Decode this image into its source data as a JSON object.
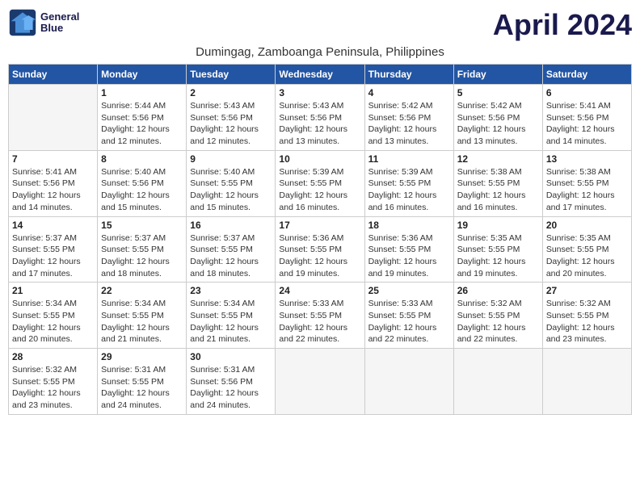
{
  "logo": {
    "line1": "General",
    "line2": "Blue"
  },
  "title": "April 2024",
  "subtitle": "Dumingag, Zamboanga Peninsula, Philippines",
  "days_of_week": [
    "Sunday",
    "Monday",
    "Tuesday",
    "Wednesday",
    "Thursday",
    "Friday",
    "Saturday"
  ],
  "weeks": [
    [
      {
        "day": "",
        "info": ""
      },
      {
        "day": "1",
        "info": "Sunrise: 5:44 AM\nSunset: 5:56 PM\nDaylight: 12 hours\nand 12 minutes."
      },
      {
        "day": "2",
        "info": "Sunrise: 5:43 AM\nSunset: 5:56 PM\nDaylight: 12 hours\nand 12 minutes."
      },
      {
        "day": "3",
        "info": "Sunrise: 5:43 AM\nSunset: 5:56 PM\nDaylight: 12 hours\nand 13 minutes."
      },
      {
        "day": "4",
        "info": "Sunrise: 5:42 AM\nSunset: 5:56 PM\nDaylight: 12 hours\nand 13 minutes."
      },
      {
        "day": "5",
        "info": "Sunrise: 5:42 AM\nSunset: 5:56 PM\nDaylight: 12 hours\nand 13 minutes."
      },
      {
        "day": "6",
        "info": "Sunrise: 5:41 AM\nSunset: 5:56 PM\nDaylight: 12 hours\nand 14 minutes."
      }
    ],
    [
      {
        "day": "7",
        "info": "Sunrise: 5:41 AM\nSunset: 5:56 PM\nDaylight: 12 hours\nand 14 minutes."
      },
      {
        "day": "8",
        "info": "Sunrise: 5:40 AM\nSunset: 5:56 PM\nDaylight: 12 hours\nand 15 minutes."
      },
      {
        "day": "9",
        "info": "Sunrise: 5:40 AM\nSunset: 5:55 PM\nDaylight: 12 hours\nand 15 minutes."
      },
      {
        "day": "10",
        "info": "Sunrise: 5:39 AM\nSunset: 5:55 PM\nDaylight: 12 hours\nand 16 minutes."
      },
      {
        "day": "11",
        "info": "Sunrise: 5:39 AM\nSunset: 5:55 PM\nDaylight: 12 hours\nand 16 minutes."
      },
      {
        "day": "12",
        "info": "Sunrise: 5:38 AM\nSunset: 5:55 PM\nDaylight: 12 hours\nand 16 minutes."
      },
      {
        "day": "13",
        "info": "Sunrise: 5:38 AM\nSunset: 5:55 PM\nDaylight: 12 hours\nand 17 minutes."
      }
    ],
    [
      {
        "day": "14",
        "info": "Sunrise: 5:37 AM\nSunset: 5:55 PM\nDaylight: 12 hours\nand 17 minutes."
      },
      {
        "day": "15",
        "info": "Sunrise: 5:37 AM\nSunset: 5:55 PM\nDaylight: 12 hours\nand 18 minutes."
      },
      {
        "day": "16",
        "info": "Sunrise: 5:37 AM\nSunset: 5:55 PM\nDaylight: 12 hours\nand 18 minutes."
      },
      {
        "day": "17",
        "info": "Sunrise: 5:36 AM\nSunset: 5:55 PM\nDaylight: 12 hours\nand 19 minutes."
      },
      {
        "day": "18",
        "info": "Sunrise: 5:36 AM\nSunset: 5:55 PM\nDaylight: 12 hours\nand 19 minutes."
      },
      {
        "day": "19",
        "info": "Sunrise: 5:35 AM\nSunset: 5:55 PM\nDaylight: 12 hours\nand 19 minutes."
      },
      {
        "day": "20",
        "info": "Sunrise: 5:35 AM\nSunset: 5:55 PM\nDaylight: 12 hours\nand 20 minutes."
      }
    ],
    [
      {
        "day": "21",
        "info": "Sunrise: 5:34 AM\nSunset: 5:55 PM\nDaylight: 12 hours\nand 20 minutes."
      },
      {
        "day": "22",
        "info": "Sunrise: 5:34 AM\nSunset: 5:55 PM\nDaylight: 12 hours\nand 21 minutes."
      },
      {
        "day": "23",
        "info": "Sunrise: 5:34 AM\nSunset: 5:55 PM\nDaylight: 12 hours\nand 21 minutes."
      },
      {
        "day": "24",
        "info": "Sunrise: 5:33 AM\nSunset: 5:55 PM\nDaylight: 12 hours\nand 22 minutes."
      },
      {
        "day": "25",
        "info": "Sunrise: 5:33 AM\nSunset: 5:55 PM\nDaylight: 12 hours\nand 22 minutes."
      },
      {
        "day": "26",
        "info": "Sunrise: 5:32 AM\nSunset: 5:55 PM\nDaylight: 12 hours\nand 22 minutes."
      },
      {
        "day": "27",
        "info": "Sunrise: 5:32 AM\nSunset: 5:55 PM\nDaylight: 12 hours\nand 23 minutes."
      }
    ],
    [
      {
        "day": "28",
        "info": "Sunrise: 5:32 AM\nSunset: 5:55 PM\nDaylight: 12 hours\nand 23 minutes."
      },
      {
        "day": "29",
        "info": "Sunrise: 5:31 AM\nSunset: 5:55 PM\nDaylight: 12 hours\nand 24 minutes."
      },
      {
        "day": "30",
        "info": "Sunrise: 5:31 AM\nSunset: 5:56 PM\nDaylight: 12 hours\nand 24 minutes."
      },
      {
        "day": "",
        "info": ""
      },
      {
        "day": "",
        "info": ""
      },
      {
        "day": "",
        "info": ""
      },
      {
        "day": "",
        "info": ""
      }
    ]
  ]
}
